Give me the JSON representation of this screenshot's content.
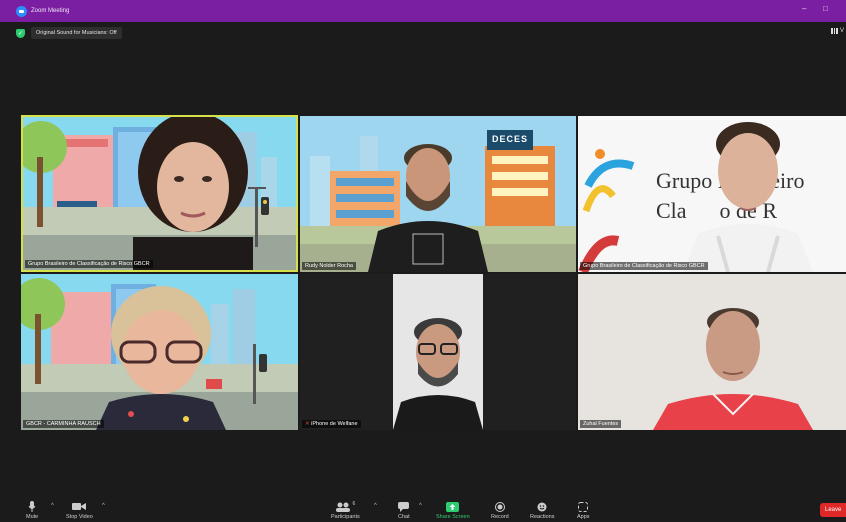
{
  "window": {
    "title": "Zoom Meeting",
    "minimize_glyph": "–",
    "maximize_glyph": "□"
  },
  "topbar": {
    "original_sound": "Original Sound for Musicians: Off",
    "view_label": "V"
  },
  "participants": [
    {
      "name": "Grupo Brasileiro de Classificação de Risco GBCR",
      "background": "city-illustration",
      "active_speaker": true
    },
    {
      "name": "Rudy Nolder Rocha",
      "background": "city-illustration"
    },
    {
      "name": "Grupo Brasileiro de Classificação de Risco GBCR",
      "background": "gbcr-banner"
    },
    {
      "name": "GBCR - CARMINHA RAUSCH",
      "background": "city-illustration"
    },
    {
      "name": "iPhone de Welfane",
      "muted": true
    },
    {
      "name": "Zuhal Fuentes"
    }
  ],
  "banner": {
    "line1": "Grupo Brasileiro",
    "line2": "Cla      o de R"
  },
  "logo": {
    "text": "DECES"
  },
  "toolbar": {
    "mute": "Mute",
    "stop_video": "Stop Video",
    "participants": "Participants",
    "participants_count": "6",
    "chat": "Chat",
    "share_screen": "Share Screen",
    "record": "Record",
    "reactions": "Reactions",
    "apps": "Apps",
    "leave": "Leave"
  },
  "colors": {
    "title_bar": "#7a1fa2",
    "share_green": "#2ecc71",
    "leave_red": "#e02828",
    "active_border": "#d6e04a"
  }
}
